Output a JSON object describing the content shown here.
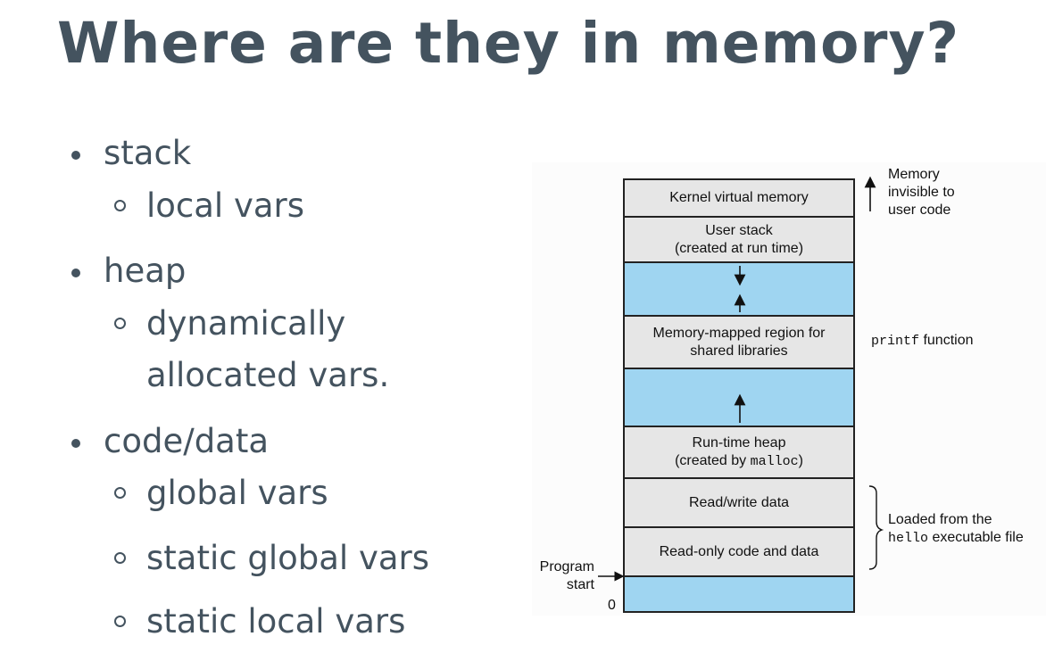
{
  "title": "Where are they in memory?",
  "bullets": [
    {
      "label": "stack",
      "children": [
        "local vars"
      ]
    },
    {
      "label": "heap",
      "children": [
        "dynamically",
        "allocated vars."
      ]
    },
    {
      "label": "code/data",
      "children": [
        "global vars",
        "static global vars",
        "static local vars"
      ]
    }
  ],
  "diagram": {
    "segments": {
      "kernel": "Kernel virtual memory",
      "user_stack_line1": "User stack",
      "user_stack_line2": "(created at run time)",
      "mmap_line1": "Memory-mapped region for",
      "mmap_line2": "shared libraries",
      "heap_line1": "Run-time heap",
      "heap_line2_prefix": "(created by ",
      "heap_line2_code": "malloc",
      "heap_line2_suffix": ")",
      "rw_data": "Read/write data",
      "ro_code": "Read-only code and data"
    },
    "annotations": {
      "invisible_line1": "Memory",
      "invisible_line2": "invisible to",
      "invisible_line3": "user code",
      "printf_code": "printf",
      "printf_text": " function",
      "loaded_line1": "Loaded from the",
      "loaded_code": "hello",
      "loaded_text": " executable file",
      "program_line1": "Program",
      "program_line2": "start",
      "zero": "0"
    },
    "colors": {
      "grey_segment": "#e6e6e6",
      "blue_segment": "#9fd5f1",
      "title_text": "#44535f"
    }
  }
}
